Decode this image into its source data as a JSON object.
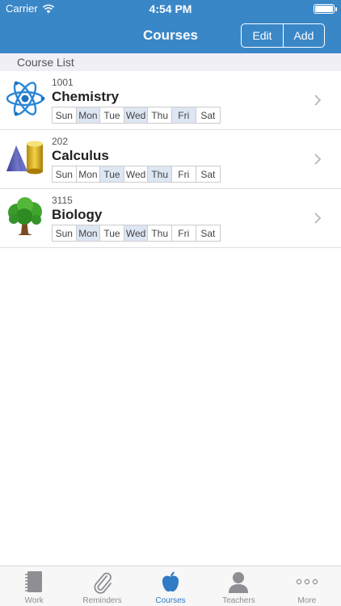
{
  "status": {
    "carrier": "Carrier",
    "time": "4:54 PM"
  },
  "nav": {
    "title": "Courses",
    "edit_label": "Edit",
    "add_label": "Add"
  },
  "section": {
    "title": "Course List"
  },
  "days": [
    "Sun",
    "Mon",
    "Tue",
    "Wed",
    "Thu",
    "Fri",
    "Sat"
  ],
  "courses": [
    {
      "code": "1001",
      "name": "Chemistry",
      "icon": "atom-icon",
      "active_days": [
        "Mon",
        "Wed",
        "Fri"
      ]
    },
    {
      "code": "202",
      "name": "Calculus",
      "icon": "geometry-shapes-icon",
      "active_days": [
        "Tue",
        "Thu"
      ]
    },
    {
      "code": "3115",
      "name": "Biology",
      "icon": "tree-icon",
      "active_days": [
        "Mon",
        "Wed"
      ]
    }
  ],
  "tabs": [
    {
      "label": "Work",
      "icon": "notebook-icon",
      "active": false
    },
    {
      "label": "Reminders",
      "icon": "paperclip-icon",
      "active": false
    },
    {
      "label": "Courses",
      "icon": "apple-icon",
      "active": true
    },
    {
      "label": "Teachers",
      "icon": "person-icon",
      "active": false
    },
    {
      "label": "More",
      "icon": "more-dots-icon",
      "active": false
    }
  ],
  "colors": {
    "nav_bar": "#3a87c8",
    "active_tab": "#2f7bc4",
    "active_day": "#dde6f3"
  }
}
